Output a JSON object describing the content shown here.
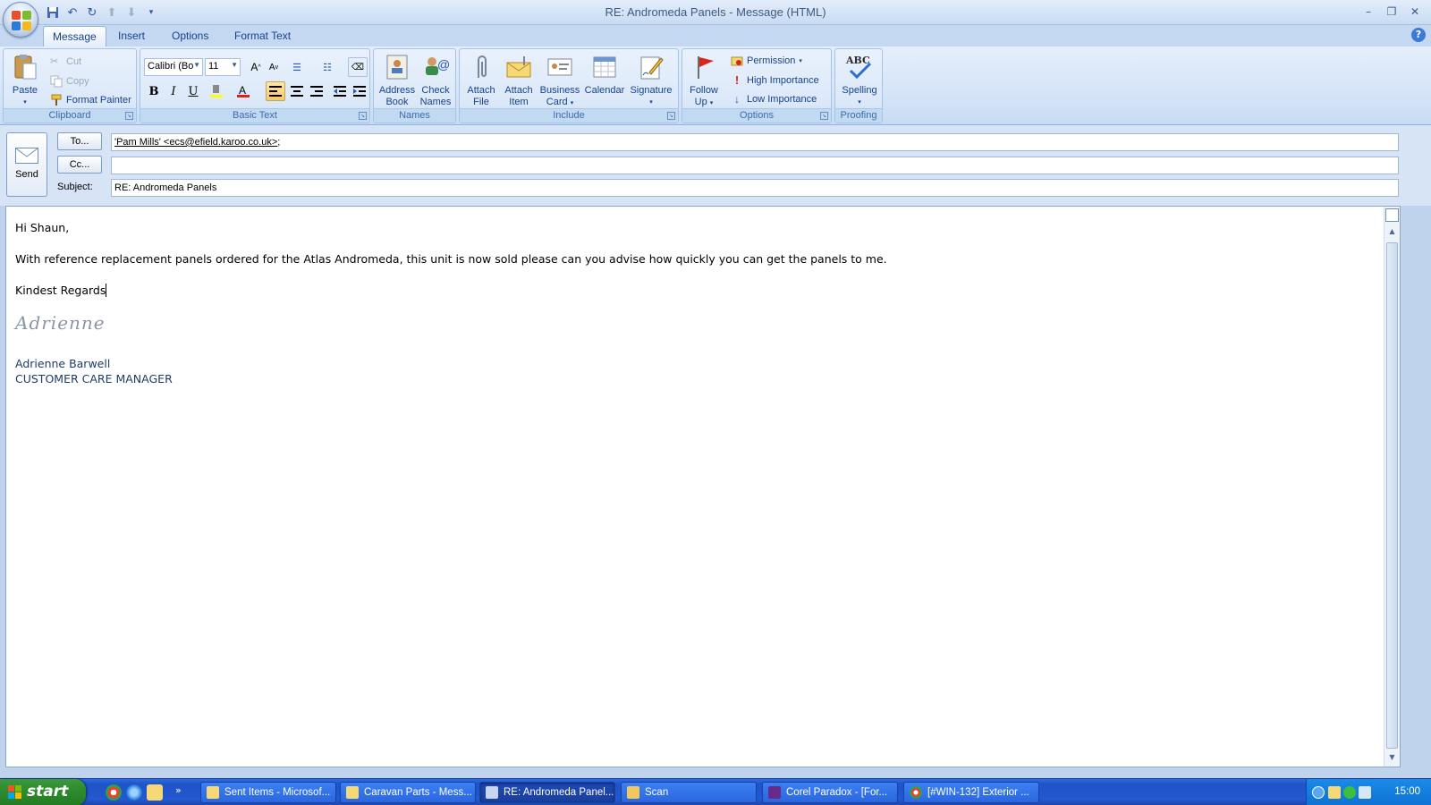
{
  "window": {
    "title": "RE: Andromeda Panels - Message (HTML)"
  },
  "ribbon": {
    "tabs": [
      "Message",
      "Insert",
      "Options",
      "Format Text"
    ],
    "clipboard": {
      "label": "Clipboard",
      "paste": "Paste",
      "cut": "Cut",
      "copy": "Copy",
      "format_painter": "Format Painter"
    },
    "basic_text": {
      "label": "Basic Text",
      "font": "Calibri (Bo",
      "size": "11",
      "bold": "B",
      "italic": "I",
      "underline": "U"
    },
    "names": {
      "label": "Names",
      "address_book_1": "Address",
      "address_book_2": "Book",
      "check_names_1": "Check",
      "check_names_2": "Names"
    },
    "include": {
      "label": "Include",
      "attach_file_1": "Attach",
      "attach_file_2": "File",
      "attach_item_1": "Attach",
      "attach_item_2": "Item",
      "business_card_1": "Business",
      "business_card_2": "Card",
      "calendar": "Calendar",
      "signature": "Signature"
    },
    "options": {
      "label": "Options",
      "follow_up_1": "Follow",
      "follow_up_2": "Up",
      "permission": "Permission",
      "high_importance": "High Importance",
      "low_importance": "Low Importance"
    },
    "proofing": {
      "label": "Proofing",
      "abc": "ABC",
      "spelling": "Spelling"
    }
  },
  "header": {
    "send": "Send",
    "to_button": "To...",
    "cc_button": "Cc...",
    "subject_label": "Subject:",
    "to_value": "'Pam Mills' <ecs@efield.karoo.co.uk>",
    "to_separator": ";",
    "cc_value": "",
    "subject_value": "RE: Andromeda Panels"
  },
  "body": {
    "greeting": "Hi Shaun,",
    "paragraph": "With reference replacement panels ordered  for the Atlas Andromeda, this unit is now sold please can you advise how quickly  you can get the panels to me.",
    "closing": "Kindest Regards",
    "signature_script": "Adrienne",
    "signature_name": "Adrienne Barwell",
    "signature_title": "CUSTOMER CARE MANAGER"
  },
  "taskbar": {
    "start": "start",
    "tasks": [
      "Sent Items - Microsof...",
      "Caravan Parts - Mess...",
      "RE: Andromeda Panel...",
      "Scan",
      "Corel Paradox - [For...",
      "[#WIN-132] Exterior ..."
    ],
    "clock": "15:00"
  },
  "colors": {
    "ribbon_bg": "#d3e3f7",
    "taskbar_blue": "#2458cf",
    "start_green": "#2e8c2e",
    "signature_blue": "#1f3c66"
  }
}
